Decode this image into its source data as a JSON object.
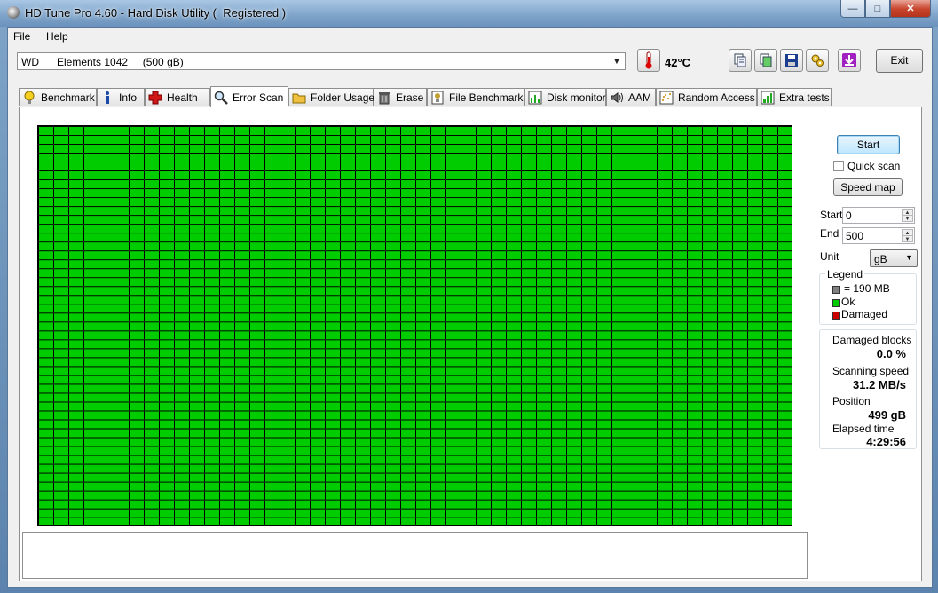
{
  "window": {
    "title": "HD Tune Pro 4.60 - Hard Disk Utility (  Registered )"
  },
  "menu": {
    "file": "File",
    "help": "Help"
  },
  "drive": {
    "selected": "WD      Elements 1042     (500 gB)"
  },
  "temperature": "42°C",
  "toolbar_icons": [
    "copy-text-icon",
    "copy-screenshot-icon",
    "save-icon",
    "options-icon",
    "download-icon"
  ],
  "exit_label": "Exit",
  "tabs": [
    {
      "label": "Benchmark",
      "icon": "lightbulb-icon"
    },
    {
      "label": "Info",
      "icon": "info-icon"
    },
    {
      "label": "Health",
      "icon": "health-cross-icon"
    },
    {
      "label": "Error Scan",
      "icon": "magnifier-icon",
      "active": true
    },
    {
      "label": "Folder Usage",
      "icon": "folder-icon"
    },
    {
      "label": "Erase",
      "icon": "trash-icon"
    },
    {
      "label": "File Benchmark",
      "icon": "file-benchmark-icon"
    },
    {
      "label": "Disk monitor",
      "icon": "disk-monitor-icon"
    },
    {
      "label": "AAM",
      "icon": "speaker-icon"
    },
    {
      "label": "Random Access",
      "icon": "random-access-icon"
    },
    {
      "label": "Extra tests",
      "icon": "extra-tests-icon"
    }
  ],
  "controls": {
    "start_label": "Start",
    "quick_scan_label": "Quick scan",
    "quick_scan_checked": false,
    "speed_map_label": "Speed map",
    "start_field_label": "Start",
    "start_value": "0",
    "end_field_label": "End",
    "end_value": "500",
    "unit_label": "Unit",
    "unit_value": "gB"
  },
  "legend": {
    "title": "Legend",
    "block": "= 190 MB",
    "ok": "Ok",
    "damaged": "Damaged",
    "colors": {
      "block": "#808080",
      "ok": "#00cc00",
      "damaged": "#cc0000"
    }
  },
  "stats": {
    "damaged_blocks_label": "Damaged blocks",
    "damaged_blocks_value": "0.0 %",
    "scanning_speed_label": "Scanning speed",
    "scanning_speed_value": "31.2 MB/s",
    "position_label": "Position",
    "position_value": "499 gB",
    "elapsed_label": "Elapsed time",
    "elapsed_value": "4:29:56"
  },
  "scan_map": {
    "block_status": "ok",
    "color": "#00cc00"
  },
  "log_text": ""
}
